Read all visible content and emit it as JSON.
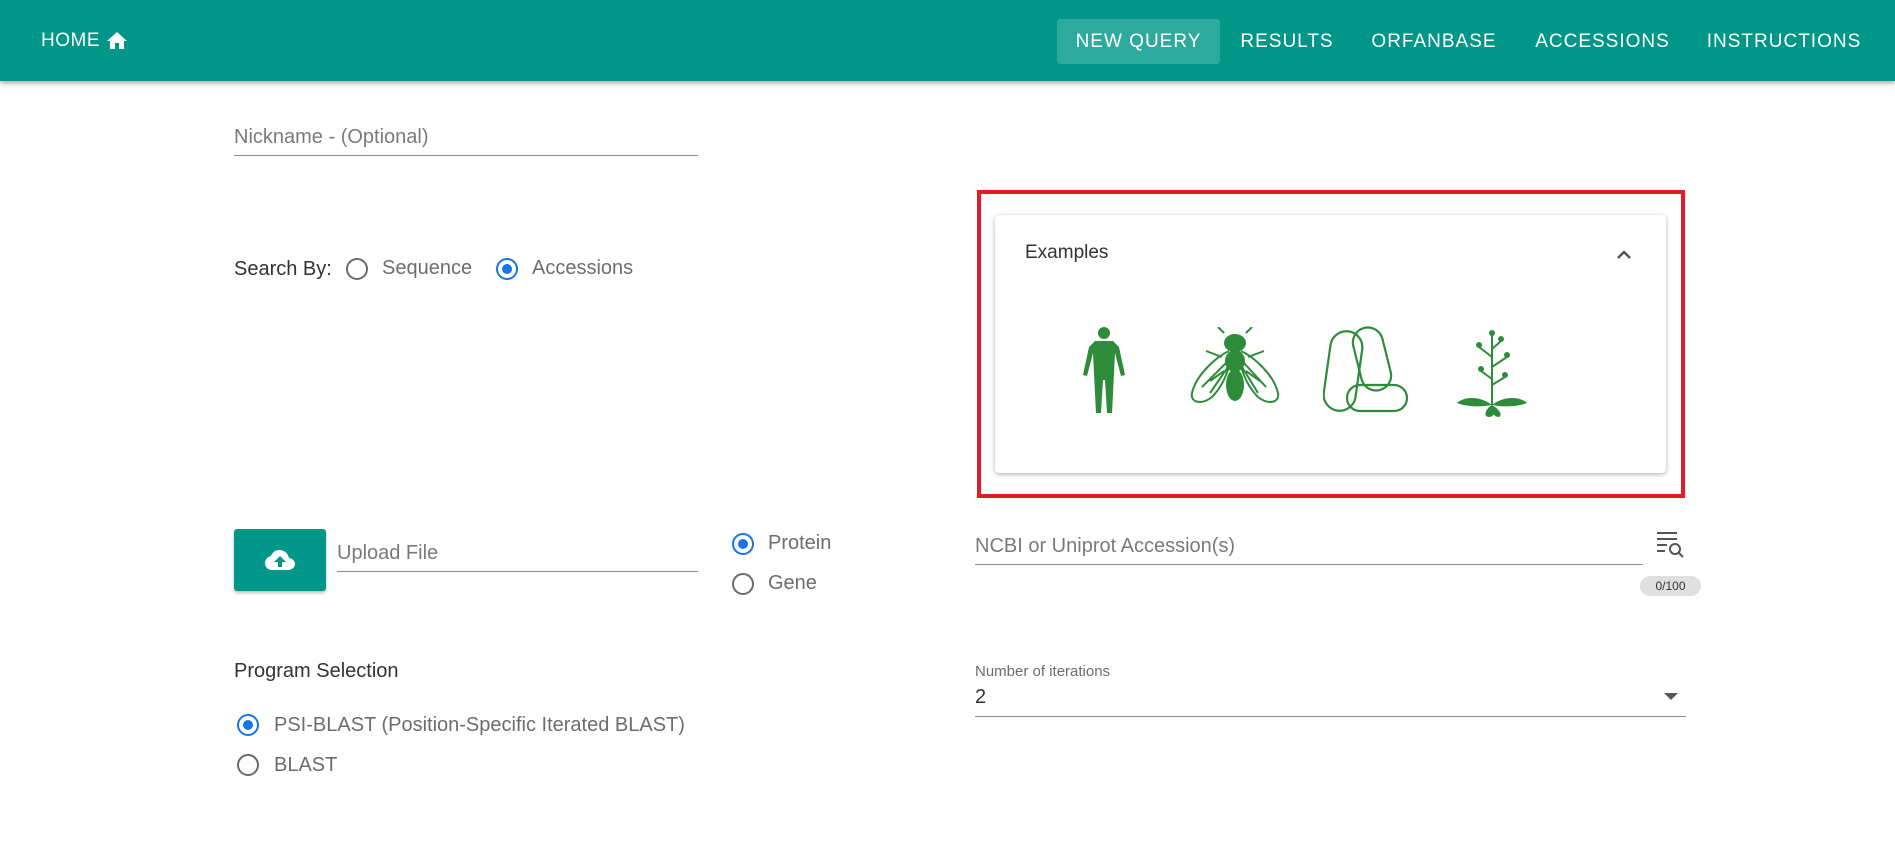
{
  "nav": {
    "home": "HOME",
    "items": [
      "NEW QUERY",
      "RESULTS",
      "ORFANBASE",
      "ACCESSIONS",
      "INSTRUCTIONS"
    ],
    "active": "NEW QUERY"
  },
  "nickname": {
    "placeholder": "Nickname - (Optional)"
  },
  "search_by": {
    "label": "Search By:",
    "options": [
      "Sequence",
      "Accessions"
    ],
    "selected": "Accessions"
  },
  "examples": {
    "title": "Examples",
    "organisms": [
      "human-icon",
      "fly-icon",
      "bacteria-icon",
      "arabidopsis-icon"
    ],
    "icon_color": "#2e8b3a"
  },
  "upload": {
    "placeholder": "Upload File"
  },
  "molecule": {
    "options": [
      "Protein",
      "Gene"
    ],
    "selected": "Protein"
  },
  "accession": {
    "placeholder": "NCBI or Uniprot Accession(s)",
    "counter": "0/100"
  },
  "program": {
    "label": "Program Selection",
    "options": [
      "PSI-BLAST (Position-Specific Iterated BLAST)",
      "BLAST"
    ],
    "selected": "PSI-BLAST (Position-Specific Iterated BLAST)"
  },
  "iterations": {
    "label": "Number of iterations",
    "value": "2"
  },
  "colors": {
    "primary": "#009688",
    "radio": "#1a73e8",
    "highlight": "#e31b23"
  }
}
